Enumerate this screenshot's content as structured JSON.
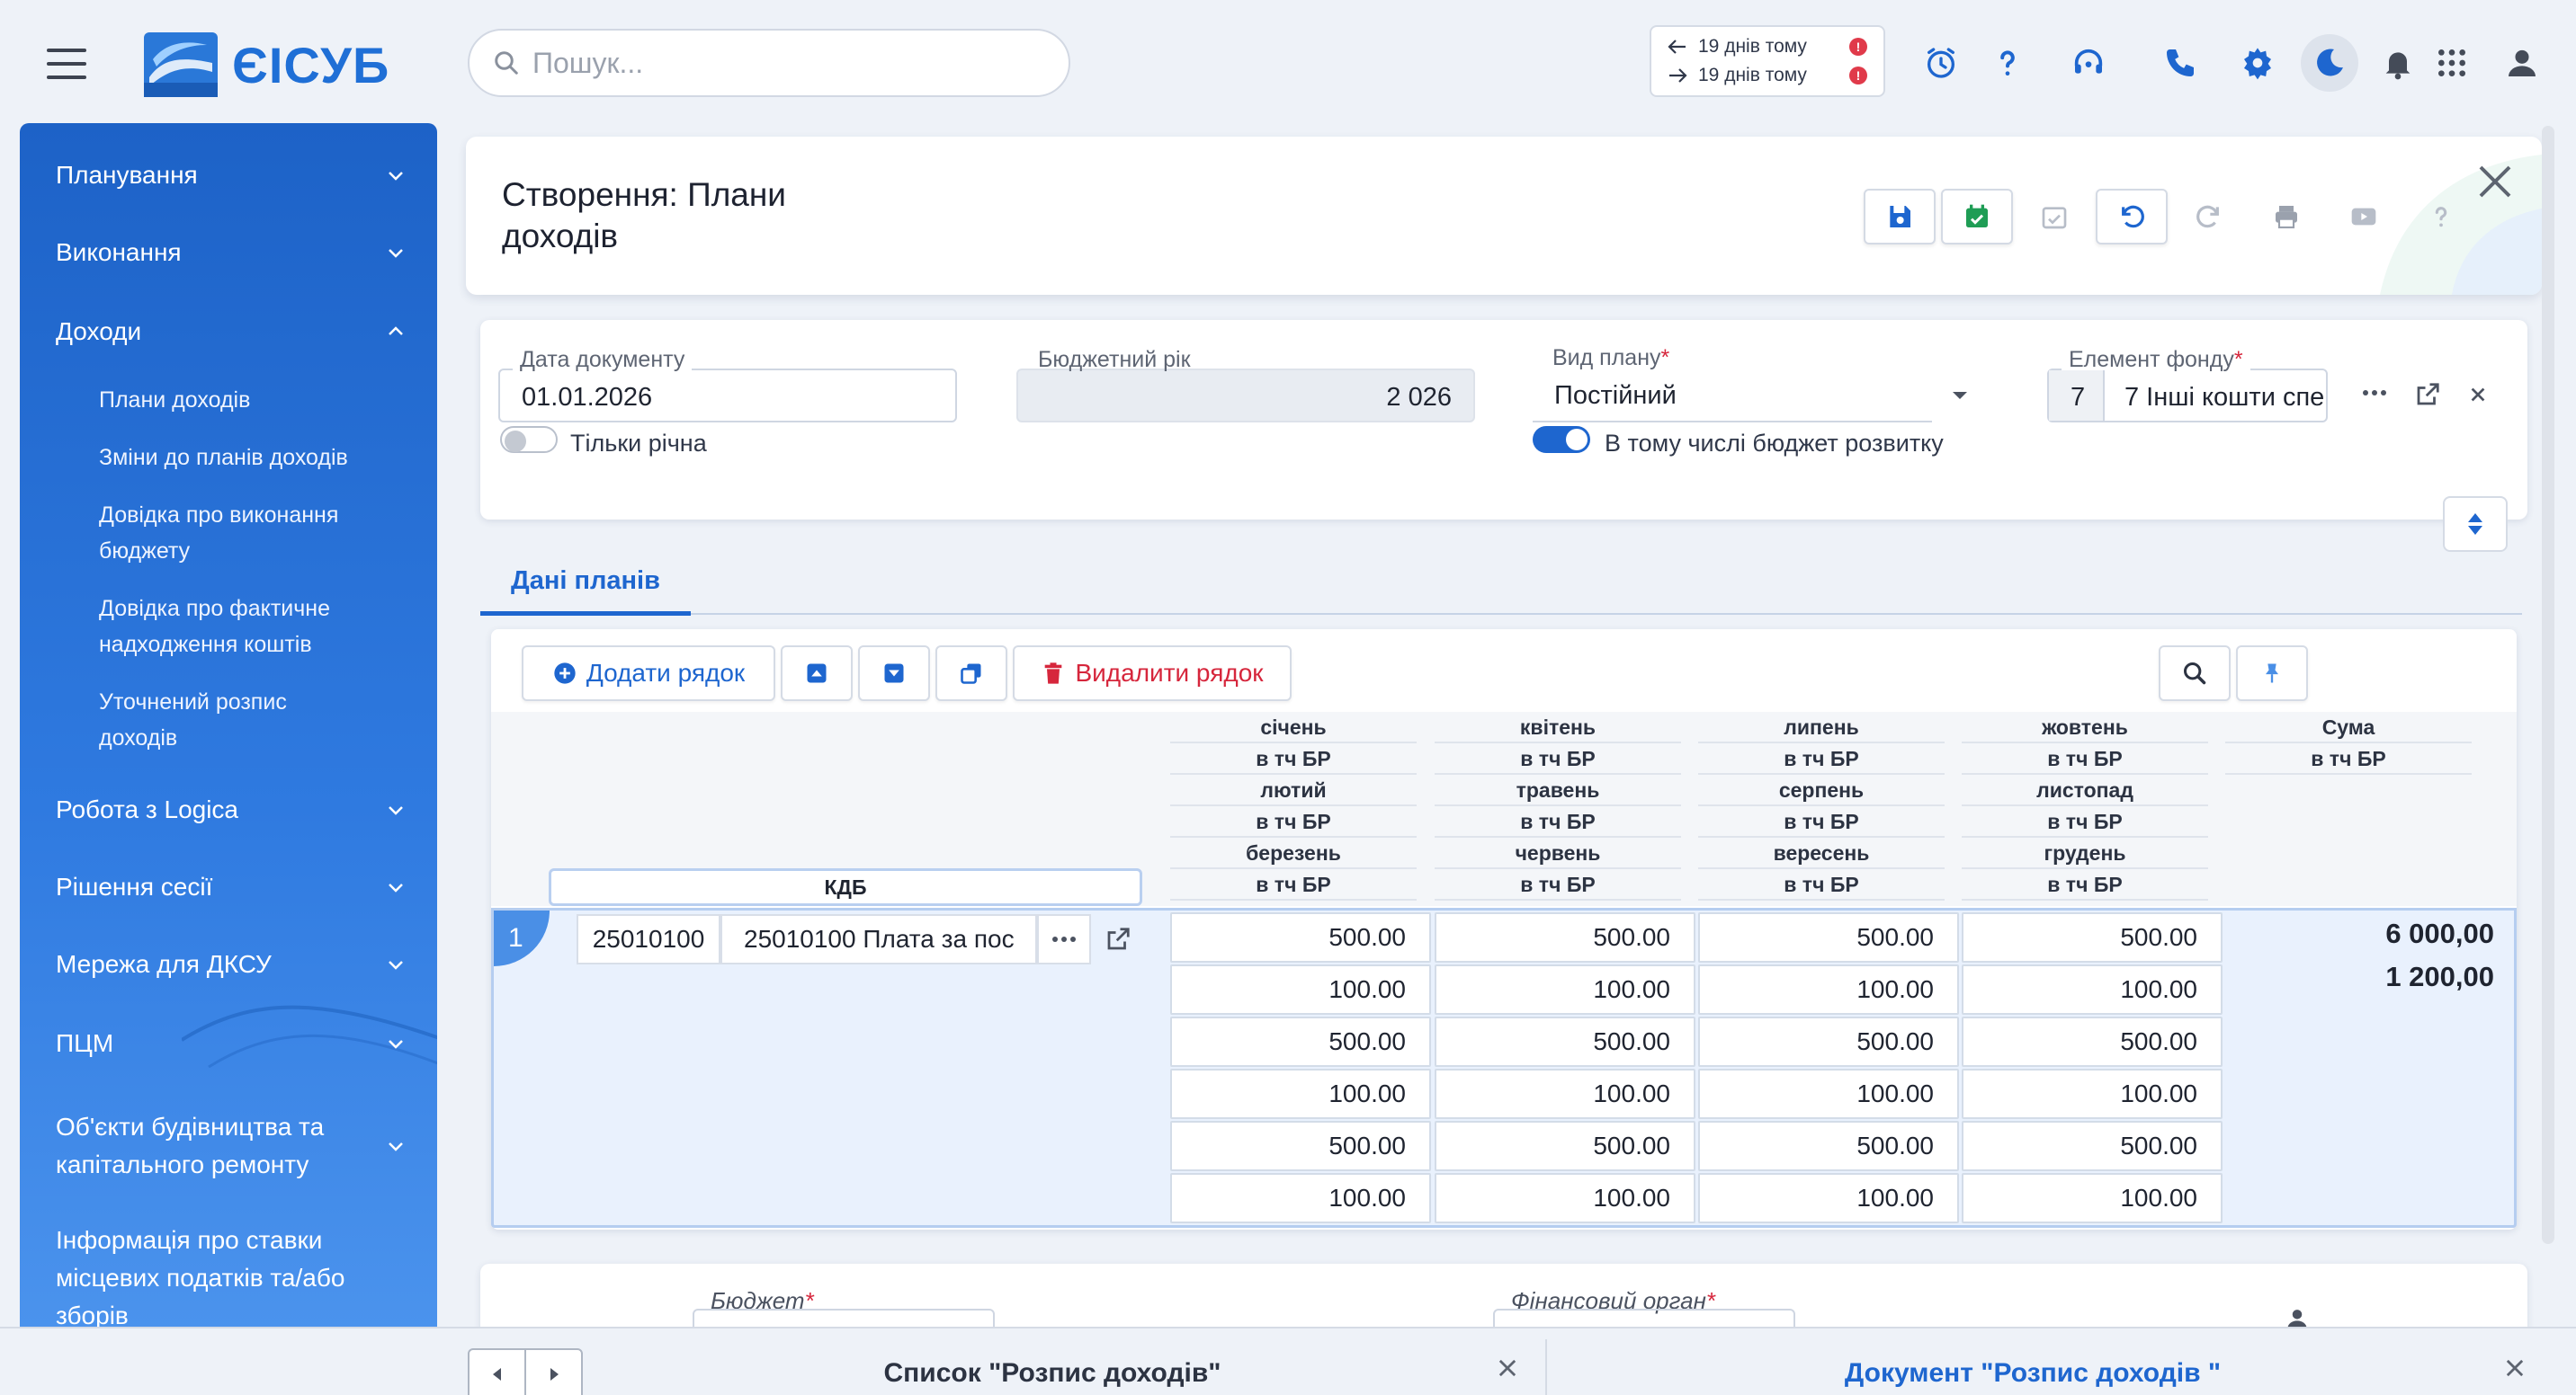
{
  "app": {
    "logo_text": "ЄІСУБ"
  },
  "search": {
    "placeholder": "Пошук..."
  },
  "history": {
    "back": "19 днів тому",
    "forward": "19 днів тому",
    "badge": "!"
  },
  "header_icons": [
    "alarm-clock-icon",
    "help-icon",
    "support-headset-icon",
    "phone-icon",
    "settings-icon",
    "dark-mode-icon",
    "bell-icon",
    "apps-grid-icon",
    "user-icon"
  ],
  "sidebar": {
    "items": [
      {
        "label": "Планування",
        "expanded": false
      },
      {
        "label": "Виконання",
        "expanded": false
      },
      {
        "label": "Доходи",
        "expanded": true
      },
      {
        "label": "Робота з Logica",
        "expanded": false
      },
      {
        "label": "Рішення сесії",
        "expanded": false
      },
      {
        "label": "Мережа для ДКСУ",
        "expanded": false
      },
      {
        "label": "ПЦМ",
        "expanded": false
      },
      {
        "label": "Об'єкти будівництва та капітального ремонту",
        "expanded": false
      },
      {
        "label": "Інформація про ставки місцевих податків та/або зборів",
        "expanded": false
      }
    ],
    "subitems": [
      "Плани доходів",
      "Зміни до планів доходів",
      "Довідка про виконання бюджету",
      "Довідка про фактичне надходження коштів",
      "Уточнений розпис доходів"
    ]
  },
  "page": {
    "title": "Створення: Плани доходів"
  },
  "form": {
    "doc_date": {
      "label": "Дата документу",
      "value": "01.01.2026"
    },
    "budget_year": {
      "label": "Бюджетний рік",
      "value": "2 026"
    },
    "plan_type": {
      "label": "Вид плану",
      "value": "Постійний",
      "required": "*"
    },
    "fund_element": {
      "label": "Елемент фонду",
      "code": "7",
      "value": "7 Інші кошти спе",
      "required": "*"
    },
    "toggle_annual": {
      "label": "Тільки річна",
      "on": false
    },
    "toggle_dev": {
      "label": "В тому числі бюджет розвитку",
      "on": true
    }
  },
  "tabs": [
    {
      "label": "Дані планів",
      "active": true
    }
  ],
  "grid": {
    "add_row": "Додати рядок",
    "delete_row": "Видалити рядок",
    "kdb_header": "КДБ",
    "columns": [
      [
        "січень",
        "в тч БР",
        "лютий",
        "в тч БР",
        "березень",
        "в тч БР"
      ],
      [
        "квітень",
        "в тч БР",
        "травень",
        "в тч БР",
        "червень",
        "в тч БР"
      ],
      [
        "липень",
        "в тч БР",
        "серпень",
        "в тч БР",
        "вересень",
        "в тч БР"
      ],
      [
        "жовтень",
        "в тч БР",
        "листопад",
        "в тч БР",
        "грудень",
        "в тч БР"
      ]
    ],
    "sum_header": [
      "Сума",
      "в тч БР"
    ],
    "rows": [
      {
        "num": "1",
        "kdb_code": "25010100",
        "kdb_name": "25010100 Плата за пос",
        "values": [
          [
            "500.00",
            "500.00",
            "500.00",
            "500.00"
          ],
          [
            "100.00",
            "100.00",
            "100.00",
            "100.00"
          ],
          [
            "500.00",
            "500.00",
            "500.00",
            "500.00"
          ],
          [
            "100.00",
            "100.00",
            "100.00",
            "100.00"
          ],
          [
            "500.00",
            "500.00",
            "500.00",
            "500.00"
          ],
          [
            "100.00",
            "100.00",
            "100.00",
            "100.00"
          ]
        ],
        "sum": "6 000,00",
        "sum_br": "1 200,00"
      }
    ]
  },
  "bottom": {
    "budget_label": "Бюджет",
    "fin_org_label": "Фінансовий орган",
    "required": "*"
  },
  "taskbar": {
    "tab1": "Список \"Розпис доходів\"",
    "tab2": "Документ \"Розпис доходів \""
  },
  "colors": {
    "accent": "#1e66cf",
    "danger": "#d6263c",
    "success": "#1f9d55"
  }
}
